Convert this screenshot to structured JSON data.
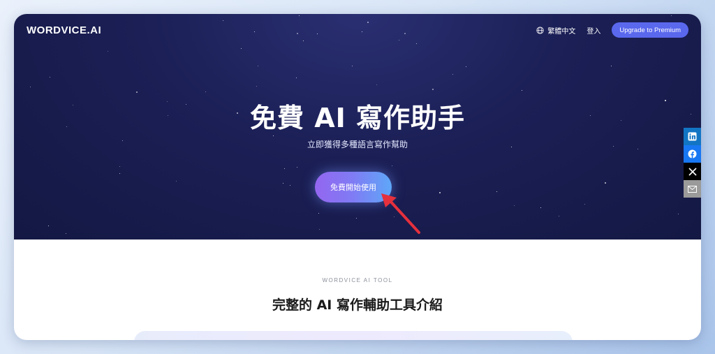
{
  "nav": {
    "logo": "WORDVICE.AI",
    "language": "繁體中文",
    "login": "登入",
    "premium_button": "Upgrade to Premium"
  },
  "hero": {
    "title": "免費 AI 寫作助手",
    "subtitle": "立即獲得多種語言寫作幫助",
    "cta_button": "免費開始使用"
  },
  "share_bar": {
    "icons": [
      "linkedin-icon",
      "facebook-icon",
      "x-icon",
      "mail-icon"
    ]
  },
  "section": {
    "eyebrow": "WORDVICE AI TOOL",
    "title": "完整的 AI 寫作輔助工具介紹"
  },
  "colors": {
    "hero_bg": "#1b1f55",
    "premium_button": "#5a68ee",
    "cta_gradient_start": "#9466f0",
    "cta_gradient_end": "#5ea7f8",
    "arrow": "#e5303d"
  }
}
